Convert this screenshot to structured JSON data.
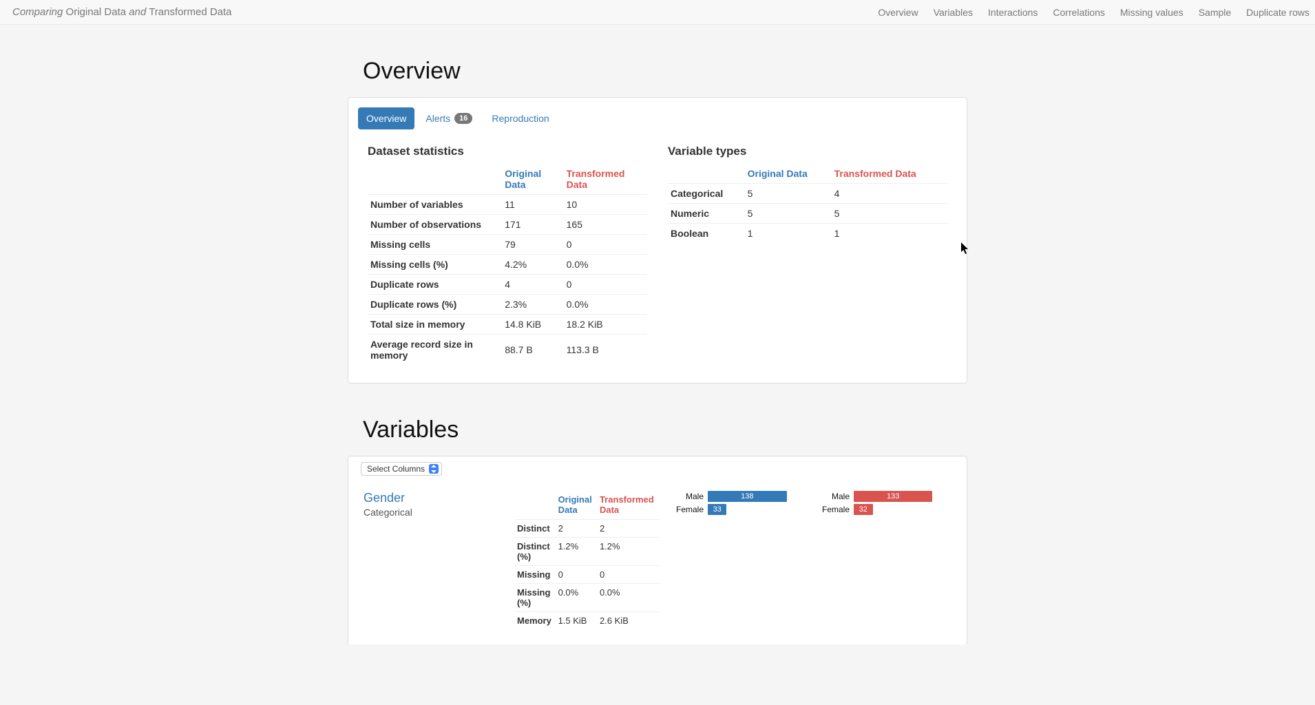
{
  "brand": {
    "prefix": "Comparing",
    "mid": "Original Data",
    "conj": "and",
    "suffix": "Transformed Data"
  },
  "nav": [
    "Overview",
    "Variables",
    "Interactions",
    "Correlations",
    "Missing values",
    "Sample",
    "Duplicate rows"
  ],
  "section": {
    "overview": "Overview",
    "variables": "Variables"
  },
  "tabs": {
    "overview": "Overview",
    "alerts": "Alerts",
    "alerts_badge": "16",
    "reproduction": "Reproduction"
  },
  "headers": {
    "orig": "Original Data",
    "trans": "Transformed Data"
  },
  "stats_title": "Dataset statistics",
  "stats": [
    {
      "k": "Number of variables",
      "a": "11",
      "b": "10"
    },
    {
      "k": "Number of observations",
      "a": "171",
      "b": "165"
    },
    {
      "k": "Missing cells",
      "a": "79",
      "b": "0"
    },
    {
      "k": "Missing cells (%)",
      "a": "4.2%",
      "b": "0.0%"
    },
    {
      "k": "Duplicate rows",
      "a": "4",
      "b": "0"
    },
    {
      "k": "Duplicate rows (%)",
      "a": "2.3%",
      "b": "0.0%"
    },
    {
      "k": "Total size in memory",
      "a": "14.8 KiB",
      "b": "18.2 KiB"
    },
    {
      "k": "Average record size in memory",
      "a": "88.7 B",
      "b": "113.3 B"
    }
  ],
  "vartypes_title": "Variable types",
  "vartypes": [
    {
      "k": "Categorical",
      "a": "5",
      "b": "4"
    },
    {
      "k": "Numeric",
      "a": "5",
      "b": "5"
    },
    {
      "k": "Boolean",
      "a": "1",
      "b": "1"
    }
  ],
  "select_label": "Select Columns",
  "var": {
    "name": "Gender",
    "type": "Categorical",
    "rows": [
      {
        "k": "Distinct",
        "a": "2",
        "b": "2"
      },
      {
        "k": "Distinct (%)",
        "a": "1.2%",
        "b": "1.2%"
      },
      {
        "k": "Missing",
        "a": "0",
        "b": "0"
      },
      {
        "k": "Missing (%)",
        "a": "0.0%",
        "b": "0.0%"
      },
      {
        "k": "Memory",
        "a": "1.5 KiB",
        "b": "2.6 KiB"
      }
    ]
  },
  "chart_data": [
    {
      "type": "bar",
      "orientation": "horizontal",
      "title": "Gender — Original Data",
      "categories": [
        "Male",
        "Female"
      ],
      "values": [
        138,
        33
      ],
      "color": "#337ab7",
      "max": 171
    },
    {
      "type": "bar",
      "orientation": "horizontal",
      "title": "Gender — Transformed Data",
      "categories": [
        "Male",
        "Female"
      ],
      "values": [
        133,
        32
      ],
      "color": "#d9534f",
      "max": 165
    }
  ]
}
